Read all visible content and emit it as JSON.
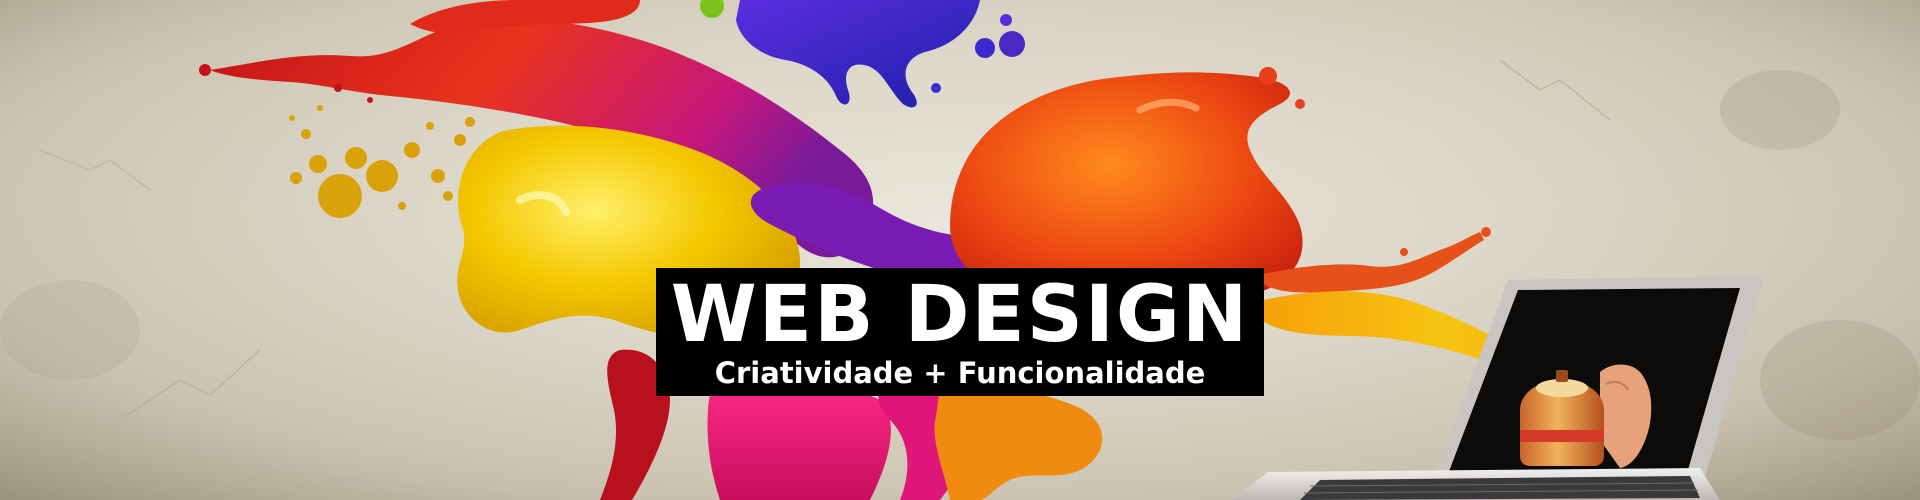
{
  "banner": {
    "title": "WEB DESIGN",
    "subtitle": "Criatividade + Funcionalidade"
  },
  "colors": {
    "wall": "#ddd7c9",
    "title_background": "#000000",
    "title_text": "#ffffff",
    "paint_red": "#d8201a",
    "paint_orange": "#f05a10",
    "paint_yellow": "#f2c200",
    "paint_magenta": "#e0157a",
    "paint_purple": "#6a1fb0",
    "paint_blue": "#2a2fc8"
  },
  "icons": {
    "laptop": "laptop-icon",
    "hand": "hand-icon",
    "spray_can": "spray-can-icon"
  }
}
